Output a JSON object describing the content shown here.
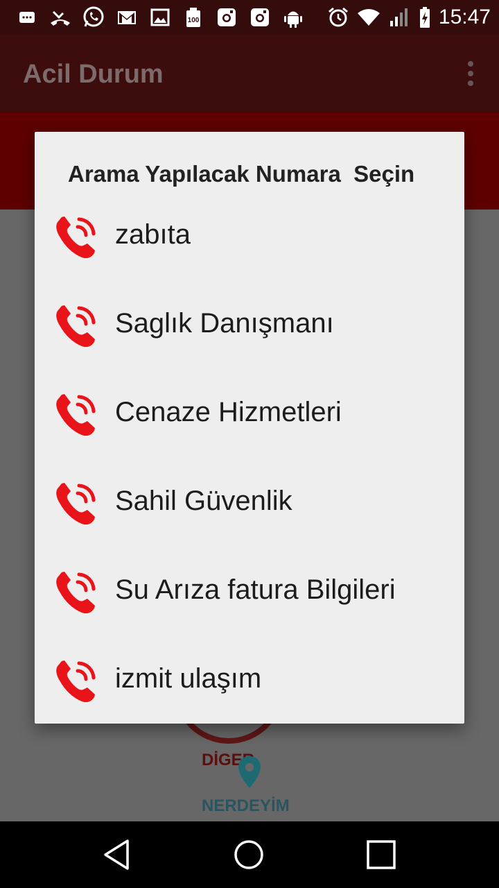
{
  "status_bar": {
    "time": "15:47",
    "left_icons": [
      "message-icon",
      "missed-call-icon",
      "whatsapp-icon",
      "gmail-icon",
      "gallery-icon",
      "battery-100-icon",
      "instagram-icon",
      "instagram-icon",
      "android-icon"
    ],
    "right_icons": [
      "alarm-icon",
      "wifi-icon",
      "signal-icon",
      "battery-charging-icon"
    ]
  },
  "app_bar": {
    "title": "Acil Durum"
  },
  "background": {
    "diger_label": "DİGER",
    "nerdeyim_label": "NERDEYİM"
  },
  "dialog": {
    "title": "Arama Yapılacak Numara  Seçin",
    "items": [
      {
        "label": "zabıta"
      },
      {
        "label": "Saglık Danışmanı"
      },
      {
        "label": "Cenaze Hizmetleri"
      },
      {
        "label": "Sahil Güvenlik"
      },
      {
        "label": "Su Arıza fatura Bilgileri"
      },
      {
        "label": "izmit ulaşım"
      }
    ]
  },
  "colors": {
    "phone_icon": "#e8141a",
    "app_bar": "#3d0d0d",
    "status_bar": "#340c0c",
    "dialog_bg": "#eeeeee"
  },
  "nav_bar": {
    "buttons": [
      "back-icon",
      "home-icon",
      "recents-icon"
    ]
  }
}
